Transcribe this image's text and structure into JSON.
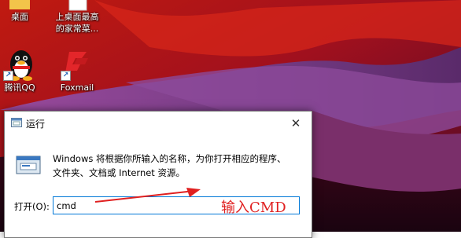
{
  "desktop": {
    "icons": [
      {
        "label_line1": "桌面",
        "label_line2": ""
      },
      {
        "label_line1": "上桌面最高",
        "label_line2": "的家常菜..."
      },
      {
        "label_line1": "腾讯QQ",
        "label_line2": ""
      },
      {
        "label_line1": "Foxmail",
        "label_line2": ""
      }
    ]
  },
  "run_dialog": {
    "title": "运行",
    "close_glyph": "✕",
    "description_line1": "Windows 将根据你所输入的名称，为你打开相应的程序、",
    "description_line2": "文件夹、文档或 Internet 资源。",
    "open_label": "打开(O):",
    "command_value": "cmd",
    "annotation": "输入CMD",
    "annotation_color": "#e02020",
    "accent_color": "#0078d7"
  }
}
